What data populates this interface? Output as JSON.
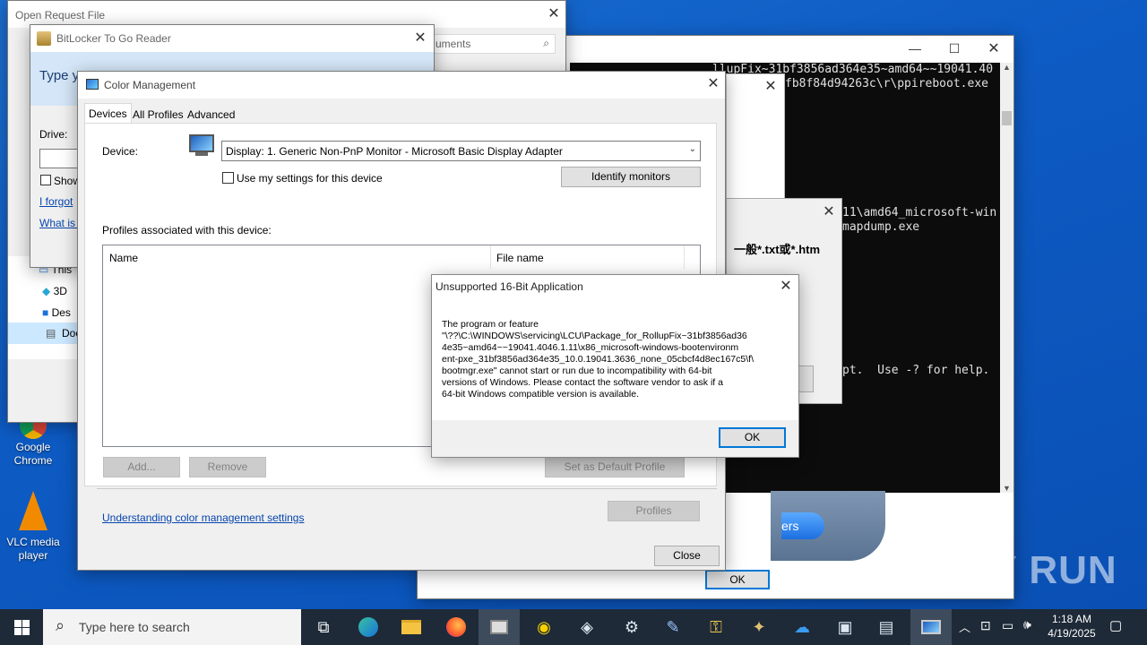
{
  "watermark": "ANY RUN",
  "desktop_icons": [
    {
      "label": "Google Chrome",
      "icon": "chrome-icon"
    },
    {
      "label": "VLC media player",
      "icon": "vlc-icon"
    }
  ],
  "console": {
    "lines": [
      "llupFix~31bf3856ad364e35~amd64~~19041.40",
      "fb8f84d94263c\\r\\ppireboot.exe",
      "",
      "11\\amd64_microsoft-win",
      "mapdump.exe",
      "pt.  Use -? for help."
    ]
  },
  "background_dialog": {
    "text": "一般*.txt或*.htm",
    "ok_label": "OK",
    "ers_label": "ers"
  },
  "open_request": {
    "title": "Open Request File",
    "search_placeholder": "uments",
    "nav_items": [
      "This",
      "3D",
      "Des",
      "Doc"
    ]
  },
  "bitlocker": {
    "title": "BitLocker To Go Reader",
    "heading": "Type y",
    "drive_label": "Drive:",
    "show_label": "Show",
    "forgot_link": "I forgot",
    "whatis_link": "What is t"
  },
  "color_mgmt": {
    "title": "Color Management",
    "tabs": [
      "Devices",
      "All Profiles",
      "Advanced"
    ],
    "device_label": "Device:",
    "device_value": "Display: 1. Generic Non-PnP Monitor - Microsoft Basic Display Adapter",
    "use_settings_label": "Use my settings for this device",
    "identify_label": "Identify monitors",
    "profiles_label": "Profiles associated with this device:",
    "col_name": "Name",
    "col_file": "File name",
    "add_label": "Add...",
    "remove_label": "Remove",
    "set_default_label": "Set as Default Profile",
    "profiles_btn_label": "Profiles",
    "understanding_link": "Understanding color management settings",
    "close_label": "Close"
  },
  "error_dialog": {
    "title": "Unsupported 16-Bit Application",
    "message_lines": [
      "The program or feature",
      "\"\\??\\C:\\WINDOWS\\servicing\\LCU\\Package_for_RollupFix~31bf3856ad36",
      "4e35~amd64~~19041.4046.1.11\\x86_microsoft-windows-bootenvironm",
      "ent-pxe_31bf3856ad364e35_10.0.19041.3636_none_05cbcf4d8ec167c5\\f\\",
      "bootmgr.exe\" cannot start or run due to incompatibility with 64-bit",
      "versions of Windows. Please contact the software vendor to ask if a",
      "64-bit Windows compatible version is available."
    ],
    "ok_label": "OK"
  },
  "taskbar": {
    "search_placeholder": "Type here to search",
    "time": "1:18 AM",
    "date": "4/19/2025"
  }
}
